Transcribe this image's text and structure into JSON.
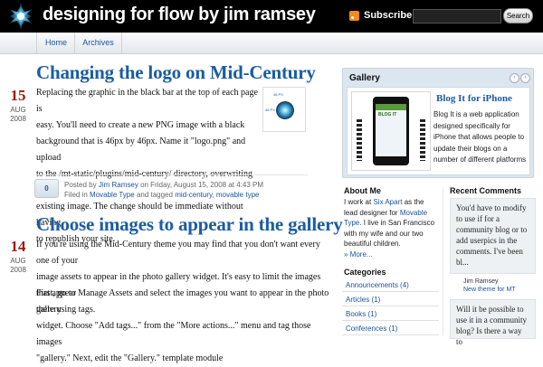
{
  "header": {
    "site_title": "designing for flow by jim ramsey",
    "subscribe_label": "Subscribe",
    "search_label": "Search",
    "search_value": ""
  },
  "nav": {
    "home": "Home",
    "archives": "Archives"
  },
  "posts": [
    {
      "title": "Changing the logo on Mid-Century",
      "day": "15",
      "month": "AUG",
      "year": "2008",
      "lines": [
        "Replacing the graphic in the black bar at the top of each page is",
        "easy. You'll need to create a new PNG image with a black",
        "background that is 46px by 46px. Name it \"logo.png\" and upload",
        "to the /mt-static/plugins/mid-century/ directory, overwriting the",
        "existing image. The change should be immediate without having",
        "to republish your site."
      ],
      "thumb_label": "46 PX",
      "thumb_side": "46 PX",
      "comment_count": "0",
      "meta_posted_by": "Posted by",
      "author": "Jim Ramsey",
      "meta_on": "on Friday, August 15, 2008 at 4:43 PM",
      "meta_filed": "Filed in",
      "category": "Movable Type",
      "meta_tagged": "and tagged",
      "tag1": "mid-century",
      "tag_sep": ",",
      "tag2": "movable type"
    },
    {
      "title": "Choose images to appear in the gallery",
      "day": "14",
      "month": "AUG",
      "year": "2008",
      "lines": [
        "If you're using the Mid-Century theme you may find that you don't want every one of your",
        "image assets to appear in the photo gallery widget. It's easy to limit the images that appear",
        "there using tags."
      ],
      "lines2": [
        "First, go to Manage Assets and select the images you want to appear in the photo gallery",
        "widget. Choose \"Add tags...\" from the \"More actions...\" menu and tag those images",
        "\"gallery.\" Next, edit the \"Gallery.\" template module"
      ]
    }
  ],
  "gallery": {
    "heading": "Gallery",
    "prev": "‹",
    "next": "›",
    "item_title": "Blog It for iPhone",
    "item_desc": "Blog It is a web application designed specifically for iPhone that allows people to update their blogs on a number of different platforms",
    "phone_text": "BLOG IT"
  },
  "about": {
    "heading": "About Me",
    "t1": "I work at ",
    "link1": "Six Apart",
    "t2": " as the lead designer for ",
    "link2": "Movable Type",
    "t3": ". I live in San Francisco with my wife and our two beautiful children.",
    "more": "» More..."
  },
  "categories": {
    "heading": "Categories",
    "items": [
      "Announcements (4)",
      "Articles (1)",
      "Books (1)",
      "Conferences (1)"
    ]
  },
  "recent_comments": {
    "heading": "Recent Comments",
    "c1": "You'd have to modify to use if for a community blog or to add userpics in the comments. I've been bl...",
    "c1_author": "Jim Ramsey",
    "c1_post": "New theme for MT",
    "c2": "Will it be possible to use it in a community blog? Is there a way to"
  }
}
